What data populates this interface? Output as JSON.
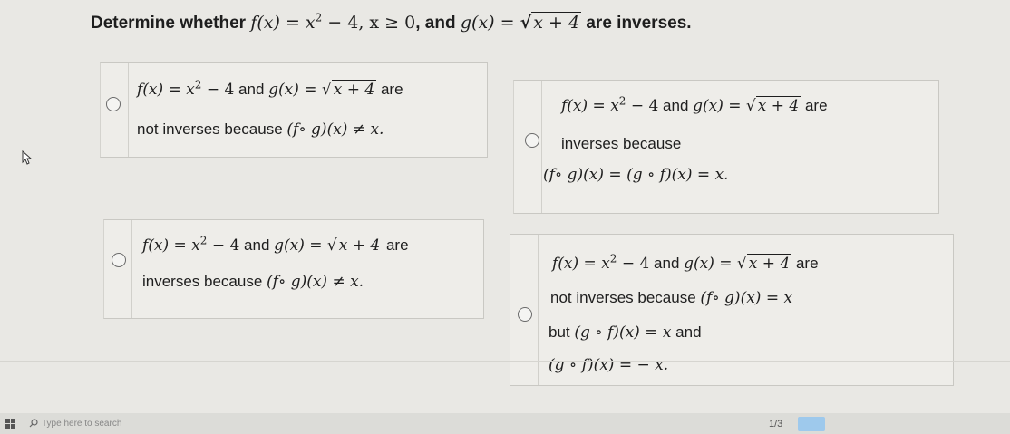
{
  "question": {
    "prefix": "Determine whether ",
    "f_def": "f(x) = x",
    "f_exp": "2",
    "f_rest": " − 4, x ≥ 0",
    "and": ", and ",
    "g_lhs": "g(x) = ",
    "g_rad": "√",
    "g_arg": "x + 4",
    "suffix": " are inverses."
  },
  "common": {
    "f_eq": "f(x) = x",
    "exp": "2",
    "f_tail": " − 4",
    "and": " and ",
    "g_eq": "g(x) = ",
    "rad": "√",
    "g_arg": "x + 4",
    "are": " are"
  },
  "options": [
    {
      "line2": "not inverses because ",
      "line2_math": "(f∘ g)(x) ≠ x."
    },
    {
      "line2": "inverses because",
      "line3_math": "(f∘ g)(x) = (g ∘ f)(x) = x."
    },
    {
      "line2": "inverses because ",
      "line2_math": "(f∘ g)(x) ≠ x."
    },
    {
      "line2": "not inverses because ",
      "line2_math": "(f∘ g)(x) = x",
      "line3_text": "but ",
      "line3_math": "(g ∘ f)(x) = x",
      "line3_tail": " and",
      "line4_math": "(g ∘ f)(x) = − x."
    }
  ],
  "taskbar": {
    "search_placeholder": "Type here to search",
    "page": "1/3"
  }
}
